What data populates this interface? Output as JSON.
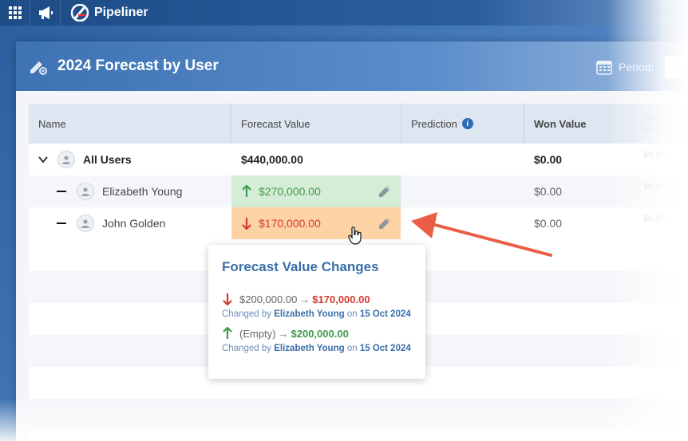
{
  "topbar": {
    "app_name": "Pipeliner",
    "icons": [
      "apps-grid-icon",
      "megaphone-icon",
      "pipeliner-logo-icon"
    ]
  },
  "header": {
    "title": "2024 Forecast by User",
    "title_icon": "edit-settings-icon",
    "period_label": "Period:",
    "period_value": "De"
  },
  "table": {
    "columns": {
      "name": "Name",
      "forecast": "Forecast Value",
      "prediction": "Prediction",
      "won": "Won Value",
      "won_vs_line1": "Won Valu",
      "won_vs_line2": "vs. Fore"
    },
    "rows": [
      {
        "name": "All Users",
        "forecast": "$440,000.00",
        "won": "$0.00",
        "won_vs": "$0.00"
      },
      {
        "name": "Elizabeth Young",
        "forecast": "$270,000.00",
        "forecast_trend": "up",
        "won": "$0.00",
        "won_vs": "$0.00"
      },
      {
        "name": "John Golden",
        "forecast": "$170,000.00",
        "forecast_trend": "down",
        "won": "$0.00",
        "won_vs": "$0.00"
      }
    ]
  },
  "popup": {
    "title": "Forecast Value Changes",
    "changes": [
      {
        "trend": "down",
        "from": "$200,000.00",
        "arrow": "→",
        "to": "$170,000.00",
        "changed_by_label": "Changed by",
        "user": "Elizabeth Young",
        "on_label": "on",
        "date": "15 Oct 2024"
      },
      {
        "trend": "up",
        "from": "(Empty)",
        "arrow": "→",
        "to": "$200,000.00",
        "changed_by_label": "Changed by",
        "user": "Elizabeth Young",
        "on_label": "on",
        "date": "15 Oct 2024"
      }
    ]
  },
  "colors": {
    "accent": "#3d72b3",
    "up": "#3e9a4d",
    "down": "#d33a2c",
    "annotation_arrow": "#ea5e47"
  }
}
